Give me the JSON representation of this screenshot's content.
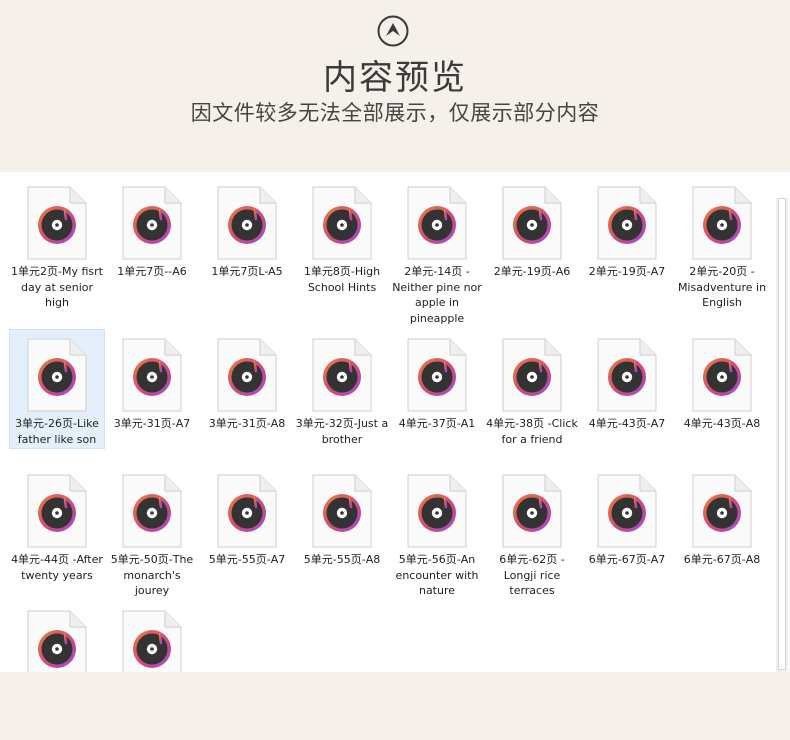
{
  "header": {
    "logo_icon": "chevron-up-circle-icon",
    "title": "内容预览",
    "subtitle": "因文件较多无法全部展示，仅展示部分内容"
  },
  "colors": {
    "background": "#f5f1ea",
    "panel": "#ffffff",
    "selection": "#e3f0fc",
    "icon_ring_start": "#f07a3a",
    "icon_ring_end": "#9b4bd8",
    "icon_disc": "#333333"
  },
  "files": [
    {
      "label": "1单元2页-My fisrt day at senior high",
      "icon": "audio-file-icon"
    },
    {
      "label": "1单元7页--A6",
      "icon": "audio-file-icon"
    },
    {
      "label": "1单元7页L-A5",
      "icon": "audio-file-icon"
    },
    {
      "label": "1单元8页-High School Hints",
      "icon": "audio-file-icon"
    },
    {
      "label": "2单元-14页 -Neither pine nor apple in pineapple",
      "icon": "audio-file-icon"
    },
    {
      "label": "2单元-19页-A6",
      "icon": "audio-file-icon"
    },
    {
      "label": "2单元-19页-A7",
      "icon": "audio-file-icon"
    },
    {
      "label": "2单元-20页 -Misadventure in English",
      "icon": "audio-file-icon"
    },
    {
      "label": "3单元-26页-Like father like son",
      "icon": "audio-file-icon",
      "selected": true
    },
    {
      "label": "3单元-31页-A7",
      "icon": "audio-file-icon"
    },
    {
      "label": "3单元-31页-A8",
      "icon": "audio-file-icon"
    },
    {
      "label": "3单元-32页-Just a brother",
      "icon": "audio-file-icon"
    },
    {
      "label": "4单元-37页-A1",
      "icon": "audio-file-icon"
    },
    {
      "label": "4单元-38页 -Click for a friend",
      "icon": "audio-file-icon"
    },
    {
      "label": "4单元-43页-A7",
      "icon": "audio-file-icon"
    },
    {
      "label": "4单元-43页-A8",
      "icon": "audio-file-icon"
    },
    {
      "label": "4单元-44页 -After twenty years",
      "icon": "audio-file-icon"
    },
    {
      "label": "5单元-50页-The monarch's jourey",
      "icon": "audio-file-icon"
    },
    {
      "label": "5单元-55页-A7",
      "icon": "audio-file-icon"
    },
    {
      "label": "5单元-55页-A8",
      "icon": "audio-file-icon"
    },
    {
      "label": "5单元-56页-An encounter with nature",
      "icon": "audio-file-icon"
    },
    {
      "label": "6单元-62页 -Longji rice terraces",
      "icon": "audio-file-icon"
    },
    {
      "label": "6单元-67页-A7",
      "icon": "audio-file-icon"
    },
    {
      "label": "6单元-67页-A8",
      "icon": "audio-file-icon"
    },
    {
      "label": "",
      "icon": "audio-file-icon"
    },
    {
      "label": "",
      "icon": "audio-file-icon"
    }
  ]
}
